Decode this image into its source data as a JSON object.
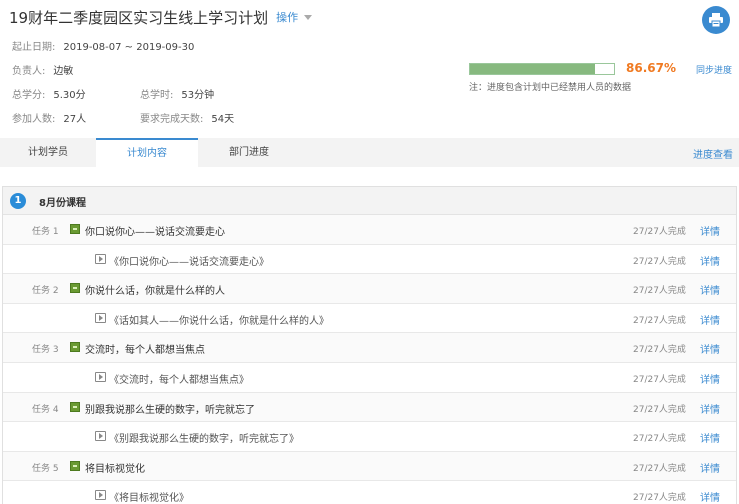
{
  "header": {
    "title": "19财年二季度园区实习生线上学习计划",
    "ops_label": "操作",
    "print_icon": "print-icon"
  },
  "info": {
    "period_label": "起止日期:",
    "period_value": "2019-08-07 ~ 2019-09-30",
    "owner_label": "负责人:",
    "owner_value": "边敏",
    "credits_label": "总学分:",
    "credits_value": "5.30分",
    "hours_label": "总学时:",
    "hours_value": "53分钟",
    "participants_label": "参加人数:",
    "participants_value": "27人",
    "days_label": "要求完成天数:",
    "days_value": "54天"
  },
  "progress": {
    "percent": 86.67,
    "percent_text": "86.67%",
    "sync_label": "同步进度",
    "note": "注：进度包含计划中已经禁用人员的数据",
    "color": "#87b97f"
  },
  "tabs": {
    "items": [
      "计划学员",
      "计划内容",
      "部门进度"
    ],
    "active_index": 1,
    "right_link": "进度查看"
  },
  "section": {
    "badge": "1",
    "title": "8月份课程",
    "rows": [
      {
        "type": "task",
        "no": "任务 1",
        "name": "你口说你心——说话交流要走心",
        "done": "27/27人完成",
        "detail": "详情"
      },
      {
        "type": "course",
        "name": "《你口说你心——说话交流要走心》",
        "done": "27/27人完成",
        "detail": "详情"
      },
      {
        "type": "task",
        "no": "任务 2",
        "name": "你说什么话，你就是什么样的人",
        "done": "27/27人完成",
        "detail": "详情"
      },
      {
        "type": "course",
        "name": "《话如其人——你说什么话，你就是什么样的人》",
        "done": "27/27人完成",
        "detail": "详情"
      },
      {
        "type": "task",
        "no": "任务 3",
        "name": "交流时，每个人都想当焦点",
        "done": "27/27人完成",
        "detail": "详情"
      },
      {
        "type": "course",
        "name": "《交流时，每个人都想当焦点》",
        "done": "27/27人完成",
        "detail": "详情"
      },
      {
        "type": "task",
        "no": "任务 4",
        "name": "别跟我说那么生硬的数字，听完就忘了",
        "done": "27/27人完成",
        "detail": "详情"
      },
      {
        "type": "course",
        "name": "《别跟我说那么生硬的数字，听完就忘了》",
        "done": "27/27人完成",
        "detail": "详情"
      },
      {
        "type": "task",
        "no": "任务 5",
        "name": "将目标视觉化",
        "done": "27/27人完成",
        "detail": "详情"
      },
      {
        "type": "course",
        "name": "《将目标视觉化》",
        "done": "27/27人完成",
        "detail": "详情"
      }
    ]
  }
}
